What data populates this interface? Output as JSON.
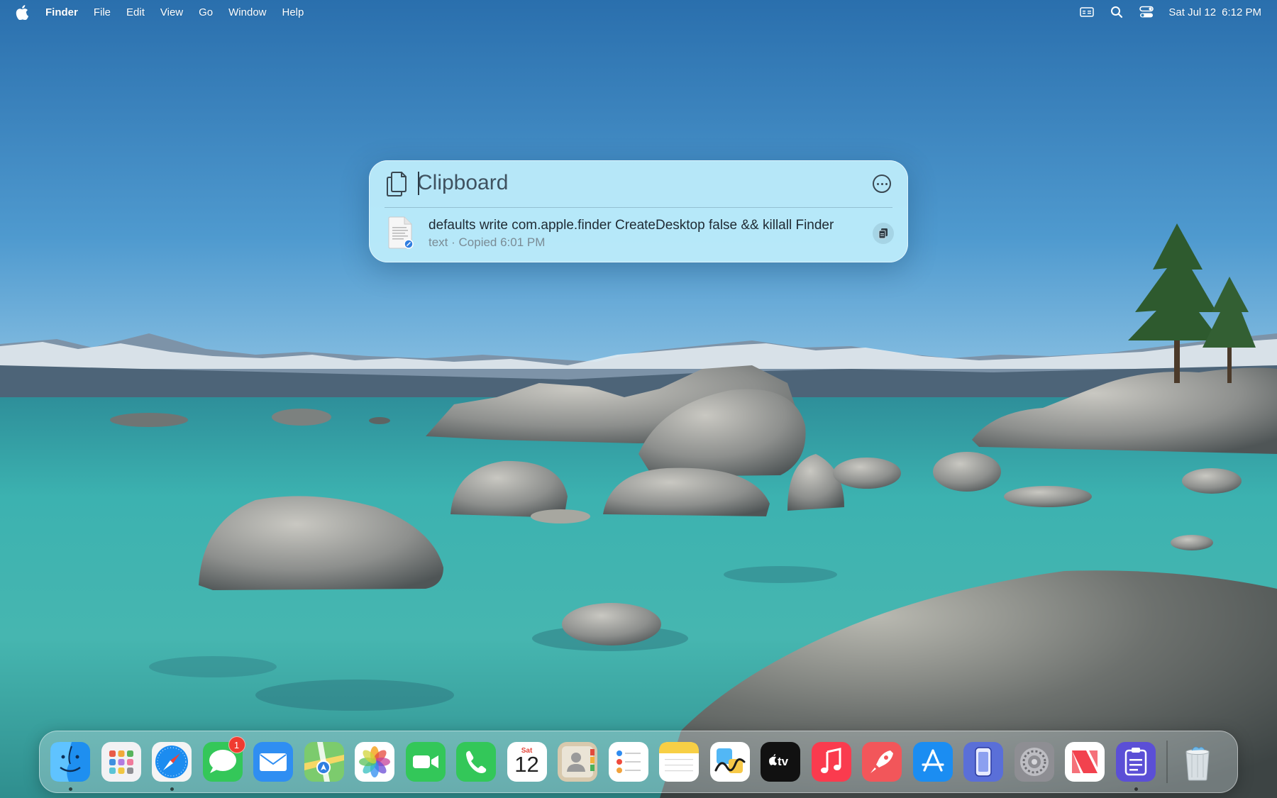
{
  "menubar": {
    "app_name": "Finder",
    "menus": [
      "File",
      "Edit",
      "View",
      "Go",
      "Window",
      "Help"
    ],
    "status_icons": [
      "input-menu-icon",
      "spotlight-search-icon",
      "control-center-icon"
    ],
    "date": "Sat Jul 12",
    "time": "6:12 PM"
  },
  "clipboard": {
    "search_placeholder": "Clipboard",
    "item": {
      "text": "defaults write com.apple.finder CreateDesktop false && killall Finder",
      "meta": "text · Copied 6:01 PM"
    }
  },
  "dock": {
    "apps": [
      {
        "name": "Finder",
        "icon": "finder-icon",
        "running": true
      },
      {
        "name": "Launchpad",
        "icon": "launchpad-icon",
        "running": false
      },
      {
        "name": "Safari",
        "icon": "safari-icon",
        "running": true
      },
      {
        "name": "Messages",
        "icon": "messages-icon",
        "running": false,
        "badge": "1"
      },
      {
        "name": "Mail",
        "icon": "mail-icon",
        "running": false
      },
      {
        "name": "Maps",
        "icon": "maps-icon",
        "running": false
      },
      {
        "name": "Photos",
        "icon": "photos-icon",
        "running": false
      },
      {
        "name": "FaceTime",
        "icon": "facetime-icon",
        "running": false
      },
      {
        "name": "Phone",
        "icon": "phone-icon",
        "running": false
      },
      {
        "name": "Calendar",
        "icon": "calendar-icon",
        "running": false,
        "day": "Sat",
        "date": "12"
      },
      {
        "name": "Contacts",
        "icon": "contacts-icon",
        "running": false
      },
      {
        "name": "Reminders",
        "icon": "reminders-icon",
        "running": false
      },
      {
        "name": "Notes",
        "icon": "notes-icon",
        "running": false
      },
      {
        "name": "Freeform",
        "icon": "freeform-icon",
        "running": false
      },
      {
        "name": "TV",
        "icon": "tv-icon",
        "running": false,
        "label": "tv"
      },
      {
        "name": "Music",
        "icon": "music-icon",
        "running": false
      },
      {
        "name": "Rocket Typist",
        "icon": "rocket-icon",
        "running": false
      },
      {
        "name": "App Store",
        "icon": "app-store-icon",
        "running": false
      },
      {
        "name": "iPhone Mirroring",
        "icon": "iphone-mirroring-icon",
        "running": false
      },
      {
        "name": "System Settings",
        "icon": "system-settings-icon",
        "running": false
      },
      {
        "name": "News",
        "icon": "news-icon",
        "running": false
      },
      {
        "name": "Clipboard Manager",
        "icon": "clipboard-app-icon",
        "running": true
      }
    ],
    "trash": {
      "name": "Trash",
      "icon": "trash-icon"
    }
  },
  "colors": {
    "sky_top": "#2a76b5",
    "lake": "#3fb3b2",
    "panel": "#bdeefc",
    "badge": "#f03b30"
  }
}
